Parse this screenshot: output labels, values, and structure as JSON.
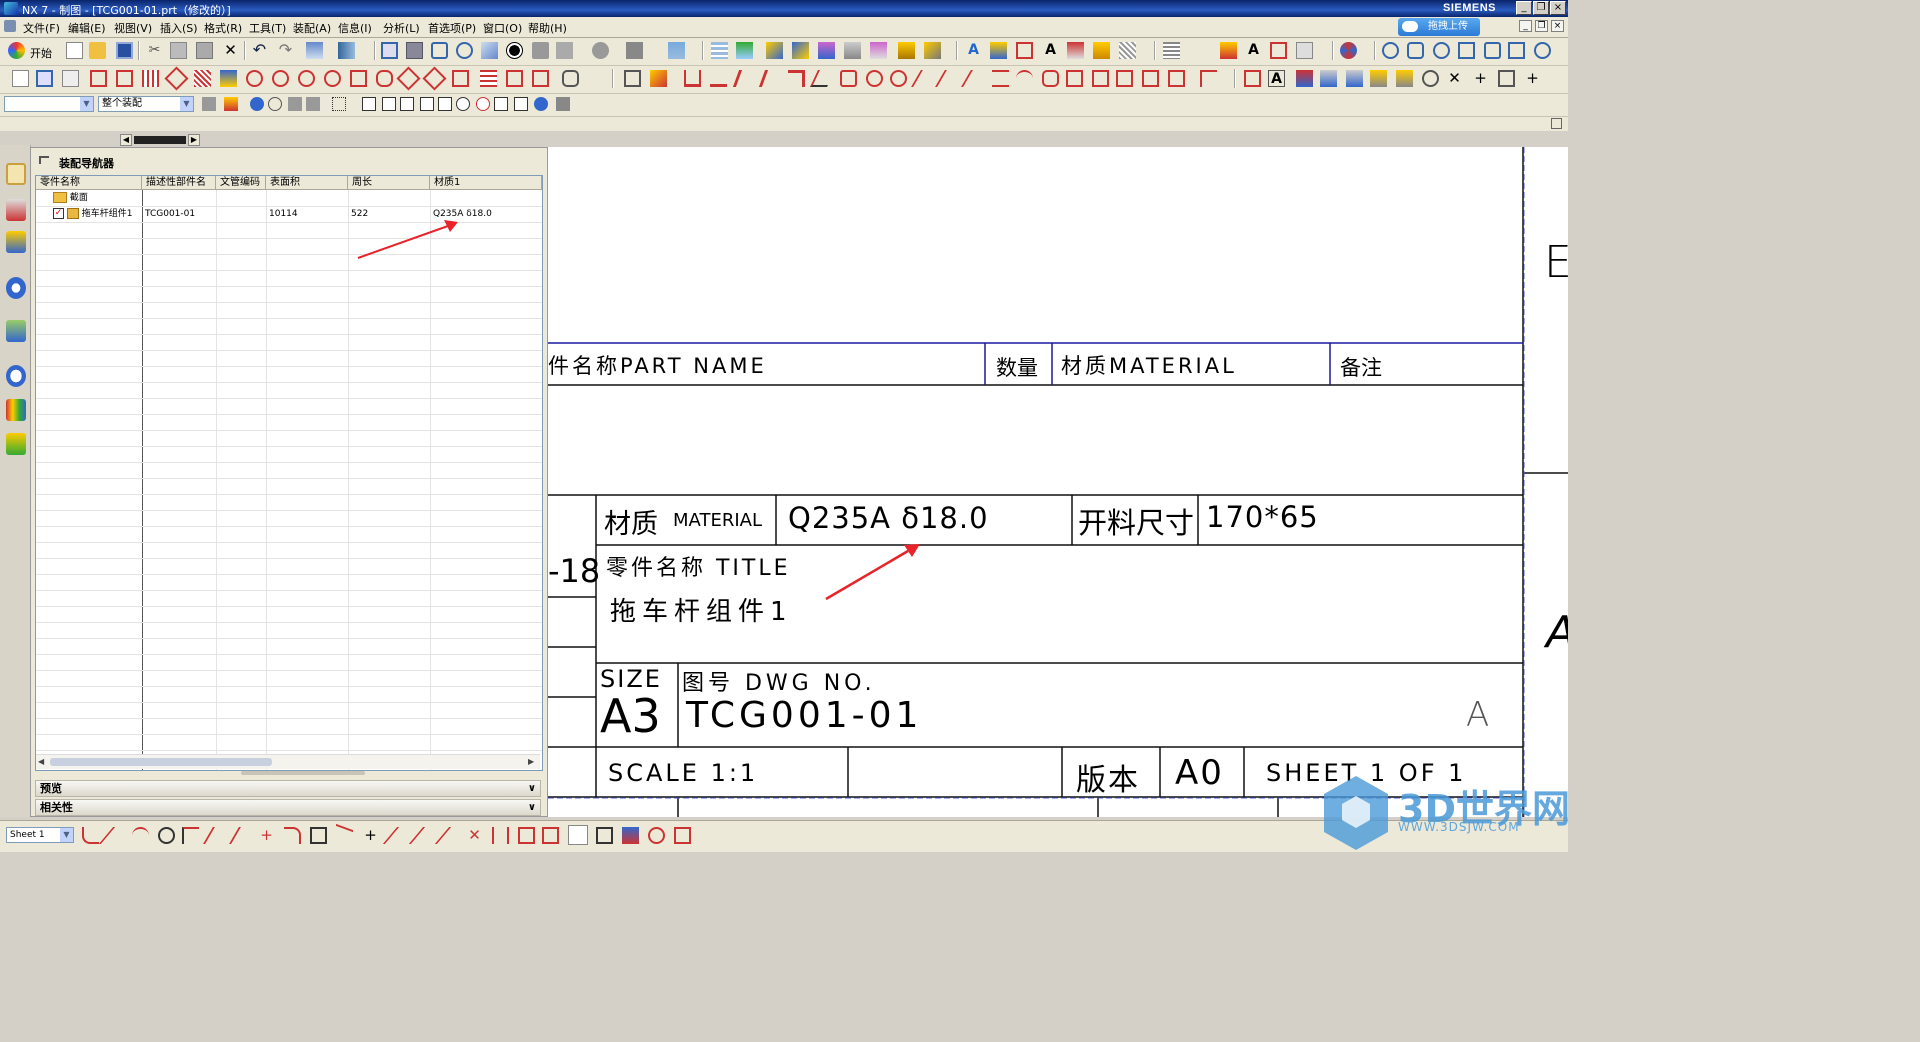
{
  "window": {
    "title": "NX 7 - 制图 - [TCG001-01.prt（修改的）]",
    "brand": "SIEMENS",
    "upload_button": "拖拽上传"
  },
  "menu": [
    "文件(F)",
    "编辑(E)",
    "视图(V)",
    "插入(S)",
    "格式(R)",
    "工具(T)",
    "装配(A)",
    "信息(I)",
    "分析(L)",
    "首选项(P)",
    "窗口(O)",
    "帮助(H)"
  ],
  "toolbar": {
    "start_label": "开始",
    "selection_filter": "",
    "assembly_scope": "整个装配"
  },
  "navigator": {
    "title": "装配导航器",
    "columns": [
      "零件名称",
      "描述性部件名",
      "文管编码",
      "表面积",
      "周长",
      "材质1"
    ],
    "rows": [
      {
        "name": "截面",
        "desc": "",
        "code": "",
        "area": "",
        "perimeter": "",
        "material": ""
      },
      {
        "name": "拖车杆组件1",
        "desc": "TCG001-01",
        "code": "",
        "area": "10114",
        "perimeter": "522",
        "material": "Q235A δ18.0"
      }
    ],
    "preview_label": "预览",
    "related_label": "相关性"
  },
  "drawing": {
    "header_part_name": "件名称PART  NAME",
    "header_qty": "数量",
    "header_material": "材质MATERIAL",
    "header_note": "备注",
    "material_label_cn": "材质",
    "material_label_en": "MATERIAL",
    "material_value": "Q235A δ18.0",
    "blank_size_label": "开料尺寸",
    "blank_size_value": "170*65",
    "left_fragment": "-18",
    "title_label": "零件名称  TITLE",
    "title_value": "拖车杆组件1",
    "size_label": "SIZE",
    "size_value": "A3",
    "dwg_no_label": "图号  DWG  NO.",
    "dwg_no_value": "TCG001-01",
    "revision_letter": "A",
    "scale_label": "SCALE  1:1",
    "version_label": "版本",
    "version_value": "A0",
    "sheet_label": "SHEET  1  OF  1",
    "right_letter_top": "E",
    "right_letter_mid": "A"
  },
  "statusbar": {
    "sheet_select": "Sheet 1"
  },
  "watermark": {
    "name": "3D世界网",
    "url": "WWW.3DSJW.COM"
  }
}
